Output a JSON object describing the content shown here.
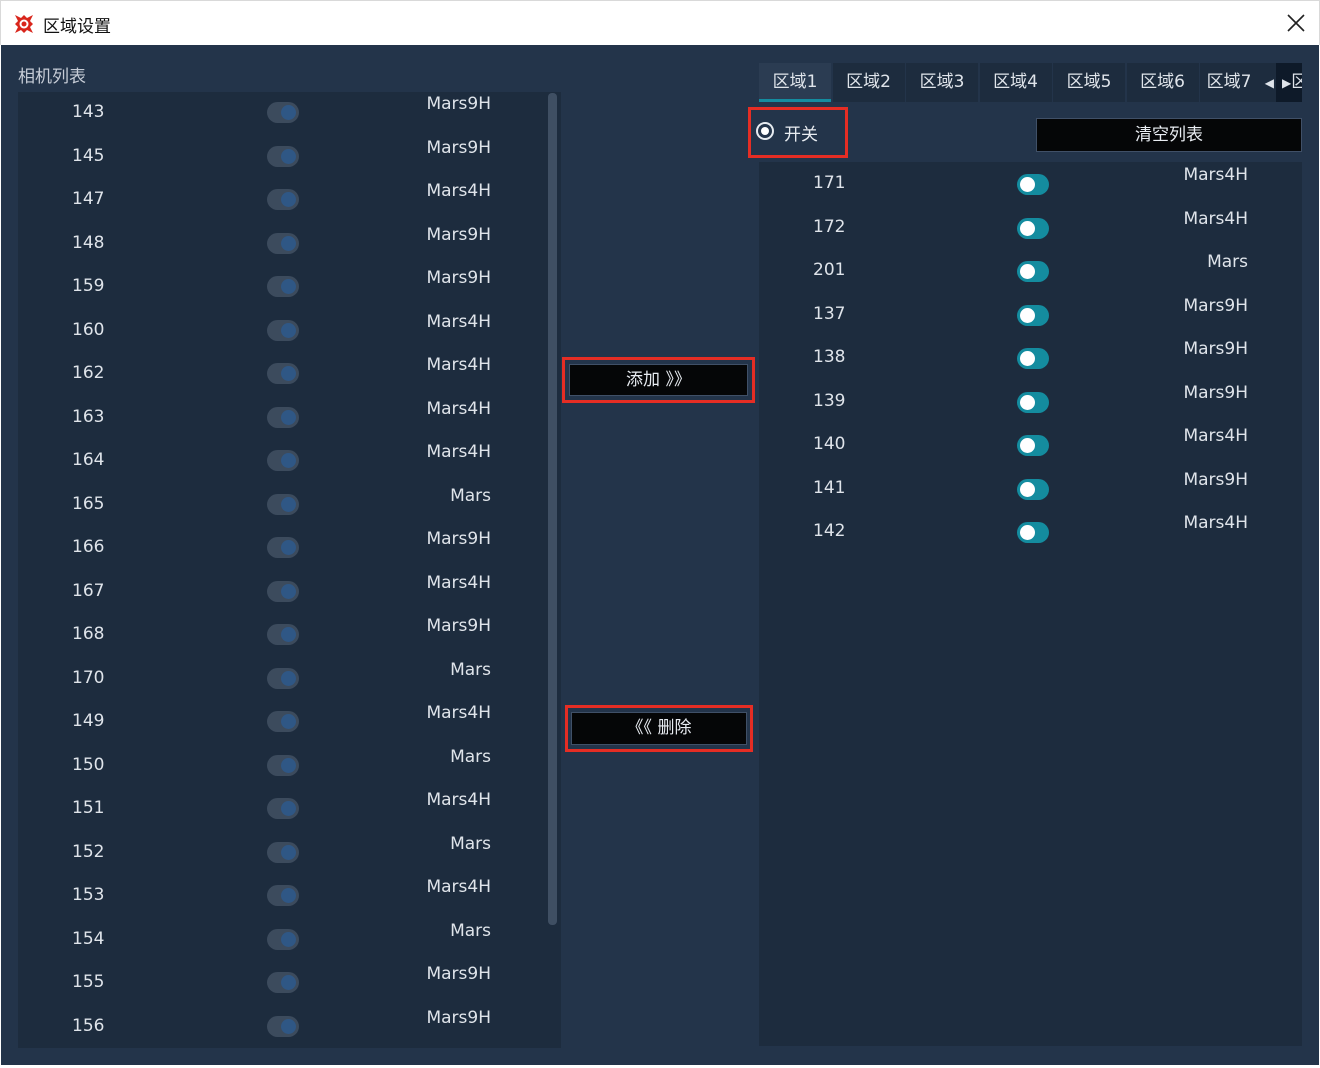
{
  "window": {
    "title": "区域设置",
    "accent": "#148c9f",
    "highlight": "#e52d24"
  },
  "left": {
    "title": "相机列表",
    "cameras": [
      {
        "id": "143",
        "model": "Mars9H",
        "enabled": false
      },
      {
        "id": "145",
        "model": "Mars9H",
        "enabled": false
      },
      {
        "id": "147",
        "model": "Mars4H",
        "enabled": false
      },
      {
        "id": "148",
        "model": "Mars9H",
        "enabled": false
      },
      {
        "id": "159",
        "model": "Mars9H",
        "enabled": false
      },
      {
        "id": "160",
        "model": "Mars4H",
        "enabled": false
      },
      {
        "id": "162",
        "model": "Mars4H",
        "enabled": false
      },
      {
        "id": "163",
        "model": "Mars4H",
        "enabled": false
      },
      {
        "id": "164",
        "model": "Mars4H",
        "enabled": false
      },
      {
        "id": "165",
        "model": "Mars",
        "enabled": false
      },
      {
        "id": "166",
        "model": "Mars9H",
        "enabled": false
      },
      {
        "id": "167",
        "model": "Mars4H",
        "enabled": false
      },
      {
        "id": "168",
        "model": "Mars9H",
        "enabled": false
      },
      {
        "id": "170",
        "model": "Mars",
        "enabled": false
      },
      {
        "id": "149",
        "model": "Mars4H",
        "enabled": false
      },
      {
        "id": "150",
        "model": "Mars",
        "enabled": false
      },
      {
        "id": "151",
        "model": "Mars4H",
        "enabled": false
      },
      {
        "id": "152",
        "model": "Mars",
        "enabled": false
      },
      {
        "id": "153",
        "model": "Mars4H",
        "enabled": false
      },
      {
        "id": "154",
        "model": "Mars",
        "enabled": false
      },
      {
        "id": "155",
        "model": "Mars9H",
        "enabled": false
      },
      {
        "id": "156",
        "model": "Mars9H",
        "enabled": false
      }
    ]
  },
  "actions": {
    "add_label": "添加 》》",
    "remove_label": "《《 删除"
  },
  "tabs": {
    "items": [
      "区域1",
      "区域2",
      "区域3",
      "区域4",
      "区域5",
      "区域6",
      "区域7"
    ],
    "active": 0,
    "prev_icon": "◀",
    "next_icon": "▶",
    "next_overflow_text": "区"
  },
  "right": {
    "switch_label": "开关",
    "switch_checked": true,
    "clear_label": "清空列表",
    "cameras": [
      {
        "id": "171",
        "model": "Mars4H",
        "enabled": true
      },
      {
        "id": "172",
        "model": "Mars4H",
        "enabled": true
      },
      {
        "id": "201",
        "model": "Mars",
        "enabled": true
      },
      {
        "id": "137",
        "model": "Mars9H",
        "enabled": true
      },
      {
        "id": "138",
        "model": "Mars9H",
        "enabled": true
      },
      {
        "id": "139",
        "model": "Mars9H",
        "enabled": true
      },
      {
        "id": "140",
        "model": "Mars4H",
        "enabled": true
      },
      {
        "id": "141",
        "model": "Mars9H",
        "enabled": true
      },
      {
        "id": "142",
        "model": "Mars4H",
        "enabled": true
      }
    ]
  }
}
